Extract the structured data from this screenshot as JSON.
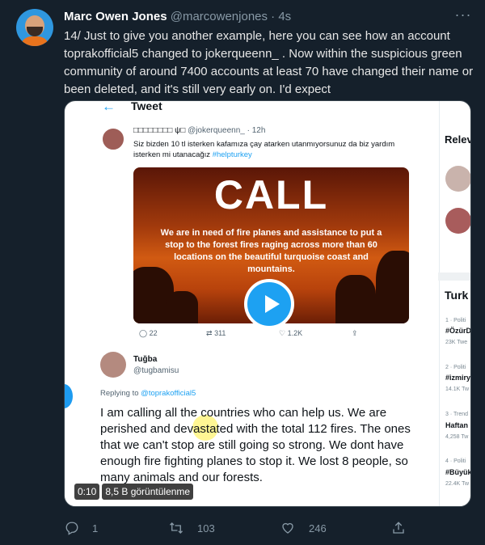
{
  "tweet": {
    "name": "Marc Owen Jones",
    "handle": "@marcowenjones",
    "time": "· 4s",
    "more": "···",
    "text": "14/ Just to give you another example, here you can see how an account toprakofficial5 changed to jokerqueenn_ . Now within the suspicious green community of around 7400 accounts at least 70 have changed their name or been deleted, and it's still very early on. I'd expect"
  },
  "media": {
    "back": "←",
    "title": "Tweet",
    "quoted": {
      "name": "□□□□□□□□ ψ□",
      "handle": "@jokerqueenn_ · 12h",
      "text": "Siz bizden 10 tl isterken kafamıza çay atarken utanmıyorsunuz da biz yardım isterken mi utanacağız",
      "hashtag": "#helpturkey",
      "image_title": "CALL",
      "image_text": "We are in need of fire planes and assistance to put a stop to the forest fires raging across more than 60 locations on the beautiful turquoise coast and mountains.",
      "replies": "22",
      "retweets": "311",
      "likes": "1.2K"
    },
    "reply": {
      "name": "Tuğba",
      "handle": "@tugbamisu",
      "replying_label": "Replying to",
      "replying_to": "@toprakofficial5",
      "text": "I am calling all the countries who can help us. We are perished and devastated with the total 112 fires. The ones that we can't stop are still going so strong. We dont have enough fire fighting planes to stop it. We lost 8 people, so many animals and our forests."
    },
    "sidebar": {
      "relevant": "Relev",
      "trends_title": "Turk",
      "trends": [
        {
          "meta": "1 · Politi",
          "tag": "#ÖzürD",
          "count": "23K Twe"
        },
        {
          "meta": "2 · Politi",
          "tag": "#izmiry",
          "count": "14.1K Tw"
        },
        {
          "meta": "3 · Trend",
          "tag": "Haftan",
          "count": "4,258 Tw"
        },
        {
          "meta": "4 · Politi",
          "tag": "#Büyük",
          "count": "22.4K Tw"
        }
      ]
    },
    "video_time": "0:10",
    "video_views": "8,5 B görüntülenme"
  },
  "actions": {
    "replies": "1",
    "retweets": "103",
    "likes": "246"
  },
  "colors": {
    "background": "#15202b",
    "accent": "#1da1f2",
    "muted": "#8899a6"
  }
}
